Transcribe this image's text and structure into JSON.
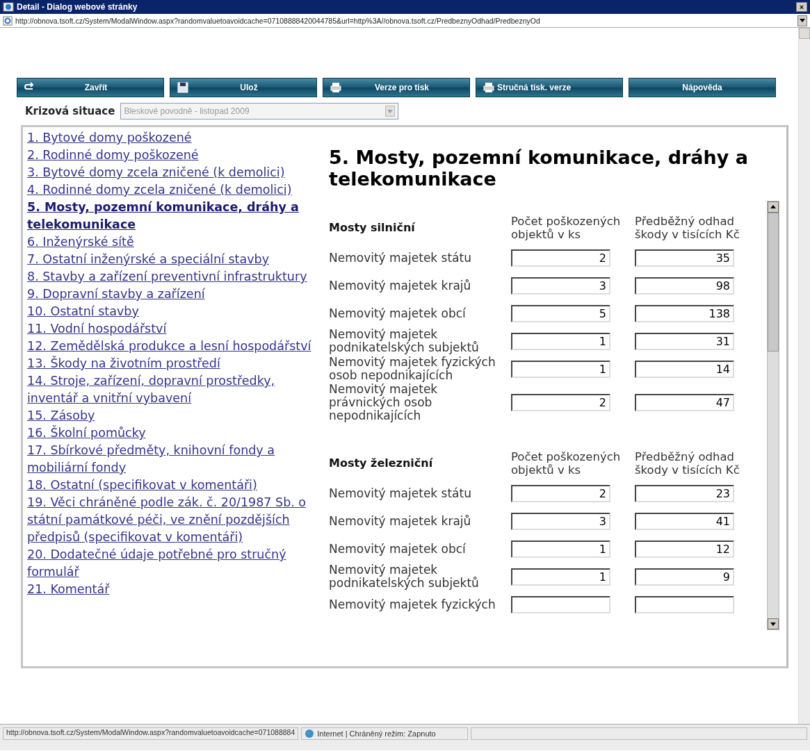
{
  "window": {
    "title": "Detail - Dialog webové stránky",
    "close": "×",
    "address": "http://obnova.tsoft.cz/System/ModalWindow.aspx?randomvaluetoavoidcache=07108888420044785&url=http%3A//obnova.tsoft.cz/PredbeznyOdhad/PredbeznyOd"
  },
  "toolbar": [
    {
      "label": "Zavřít",
      "kind": "close"
    },
    {
      "label": "Ulož",
      "kind": "save"
    },
    {
      "label": "Verze pro tisk",
      "kind": "print"
    },
    {
      "label": "Stručná tisk. verze",
      "kind": "print-short"
    },
    {
      "label": "Nápověda",
      "kind": "help"
    }
  ],
  "crisis": {
    "label": "Krizová situace",
    "value": "Bleskové povodně - listopad 2009",
    "disabled": true
  },
  "nav": [
    {
      "label": "1. Bytové domy poškozené",
      "selected": false
    },
    {
      "label": "2. Rodinné domy poškozené",
      "selected": false
    },
    {
      "label": "3. Bytové domy zcela zničené (k demolici)",
      "selected": false
    },
    {
      "label": "4. Rodinné domy zcela zničené (k demolici)",
      "selected": false
    },
    {
      "label": "5. Mosty, pozemní komunikace, dráhy a telekomunikace",
      "selected": true
    },
    {
      "label": "6. Inženýrské sítě",
      "selected": false
    },
    {
      "label": "7. Ostatní inženýrské a speciální stavby",
      "selected": false
    },
    {
      "label": "8. Stavby a zařízení preventivní infrastruktury",
      "selected": false
    },
    {
      "label": "9. Dopravní stavby a zařízení",
      "selected": false
    },
    {
      "label": "10. Ostatní stavby",
      "selected": false
    },
    {
      "label": "11. Vodní hospodářství",
      "selected": false
    },
    {
      "label": "12. Zemědělská produkce a lesní hospodářství",
      "selected": false
    },
    {
      "label": "13. Škody na životním prostředí",
      "selected": false
    },
    {
      "label": "14. Stroje, zařízení, dopravní prostředky, inventář a vnitřní vybavení",
      "selected": false
    },
    {
      "label": "15. Zásoby",
      "selected": false
    },
    {
      "label": "16. Školní pomůcky",
      "selected": false
    },
    {
      "label": "17. Sbírkové předměty, knihovní fondy a mobiliární fondy",
      "selected": false
    },
    {
      "label": "18. Ostatní (specifikovat v komentáři)",
      "selected": false
    },
    {
      "label": "19. Věci chráněné podle zák. č. 20/1987 Sb. o státní památkové péči, ve znění pozdějších předpisů (specifikovat v komentáři)",
      "selected": false
    },
    {
      "label": "20. Dodatečné údaje potřebné pro stručný formulář",
      "selected": false
    },
    {
      "label": "21. Komentář",
      "selected": false
    }
  ],
  "content": {
    "heading": "5. Mosty, pozemní komunikace, dráhy a telekomunikace",
    "sections": [
      {
        "title": "Mosty silniční",
        "columns": [
          "Počet poškozených objektů v ks",
          "Předběžný odhad škody v tisících Kč"
        ],
        "rows": [
          {
            "label": "Nemovitý majetek státu",
            "count": "2",
            "estimate": "35"
          },
          {
            "label": "Nemovitý majetek krajů",
            "count": "3",
            "estimate": "98"
          },
          {
            "label": "Nemovitý majetek obcí",
            "count": "5",
            "estimate": "138"
          },
          {
            "label": "Nemovitý majetek podnikatelských subjektů",
            "count": "1",
            "estimate": "31"
          },
          {
            "label": "Nemovitý majetek fyzických osob nepodnikajících",
            "count": "1",
            "estimate": "14"
          },
          {
            "label": "Nemovitý majetek právnických osob nepodnikajících",
            "count": "2",
            "estimate": "47"
          }
        ]
      },
      {
        "title": "Mosty železniční",
        "columns": [
          "Počet poškozených objektů v ks",
          "Předběžný odhad škody v tisících Kč"
        ],
        "rows": [
          {
            "label": "Nemovitý majetek státu",
            "count": "2",
            "estimate": "23"
          },
          {
            "label": "Nemovitý majetek krajů",
            "count": "3",
            "estimate": "41"
          },
          {
            "label": "Nemovitý majetek obcí",
            "count": "1",
            "estimate": "12"
          },
          {
            "label": "Nemovitý majetek podnikatelských subjektů",
            "count": "1",
            "estimate": "9"
          },
          {
            "label": "Nemovitý majetek fyzických"
          }
        ]
      }
    ]
  },
  "status_bar": {
    "url": "http://obnova.tsoft.cz/System/ModalWindow.aspx?randomvaluetoavoidcache=071088884",
    "zone": "Internet | Chráněný režim: Zapnuto"
  }
}
